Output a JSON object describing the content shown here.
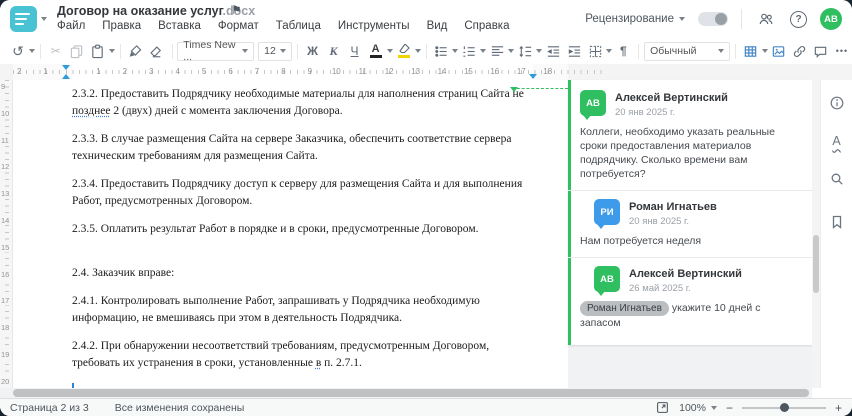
{
  "colors": {
    "accent_teal": "#49C2D4",
    "green": "#2FBE60",
    "blue": "#3D9BE9",
    "toolbar_icon_blue": "#4788C7"
  },
  "header": {
    "title": "Договор на оказание услуг",
    "title_ext": ".docx",
    "menu": [
      "Файл",
      "Правка",
      "Вставка",
      "Формат",
      "Таблица",
      "Инструменты",
      "Вид",
      "Справка"
    ],
    "review_label": "Рецензирование",
    "avatar_initials": "АВ"
  },
  "icons": {
    "undo": "↺",
    "cut": "✂",
    "flag": "⚑",
    "help": "?",
    "more": "•••",
    "spellcheck": "А",
    "minus": "−",
    "plus": "+"
  },
  "toolbar": {
    "font_name": "Times New ...",
    "font_size": "12",
    "bold": "Ж",
    "italic": "К",
    "underline": "Ч",
    "font_color_letter": "А",
    "style_name": "Обычный",
    "pilcrow": "¶"
  },
  "rulers": {
    "h_margin": [
      "2",
      "1"
    ],
    "h_page": [
      "1",
      "2",
      "3",
      "4",
      "5",
      "6",
      "7",
      "8",
      "9",
      "10",
      "11",
      "12",
      "13",
      "14",
      "15",
      "16",
      "17",
      "18"
    ],
    "v": [
      "9",
      "10",
      "11",
      "12",
      "13",
      "14",
      "15",
      "16",
      "17",
      "18",
      "19",
      "20"
    ]
  },
  "document": {
    "p232": {
      "a": "2.3.2. Предоставить Подрядчику необходимые материалы для наполнения страниц Сайта не ",
      "b": "позднее",
      "c": " 2 (двух) дней с момента заключения Договора."
    },
    "p233": "2.3.3. В случае размещения Сайта на сервере Заказчика, обеспечить соответствие сервера техническим требованиям для размещения Сайта.",
    "p234": "2.3.4. Предоставить Подрядчику доступ к серверу для размещения Сайта и для выполнения Работ, предусмотренных Договором.",
    "p235": "2.3.5. Оплатить результат Работ в порядке и в сроки, предусмотренные Договором.",
    "p24": "2.4. Заказчик вправе:",
    "p241": "2.4.1. Контролировать выполнение Работ, запрашивать у Подрядчика необходимую информацию, не вмешиваясь при этом в деятельность Подрядчика.",
    "p242": {
      "a": "2.4.2. При обнаружении несоответствий требованиям, предусмотренным Договором, требовать их устранения в сроки, установленные ",
      "b": "в",
      "c": " п. 2.7.1."
    }
  },
  "comments": {
    "thread": [
      {
        "initials": "АВ",
        "name": "Алексей Вертинский",
        "date": "20 янв 2025 г.",
        "text": "Коллеги, необходимо указать реальные сроки предоставления материалов подрядчику. Сколько времени вам потребуется?"
      },
      {
        "initials": "РИ",
        "name": "Роман Игнатьев",
        "date": "20 янв 2025 г.",
        "text": "Нам потребуется неделя"
      },
      {
        "initials": "АВ",
        "name": "Алексей Вертинский",
        "date": "26 май 2025 г.",
        "mention": "Роман Игнатьев",
        "text": " укажите 10 дней с запасом"
      }
    ]
  },
  "statusbar": {
    "page_label": "Страница 2 из 3",
    "saved_label": "Все изменения сохранены",
    "zoom_value": "100%"
  }
}
